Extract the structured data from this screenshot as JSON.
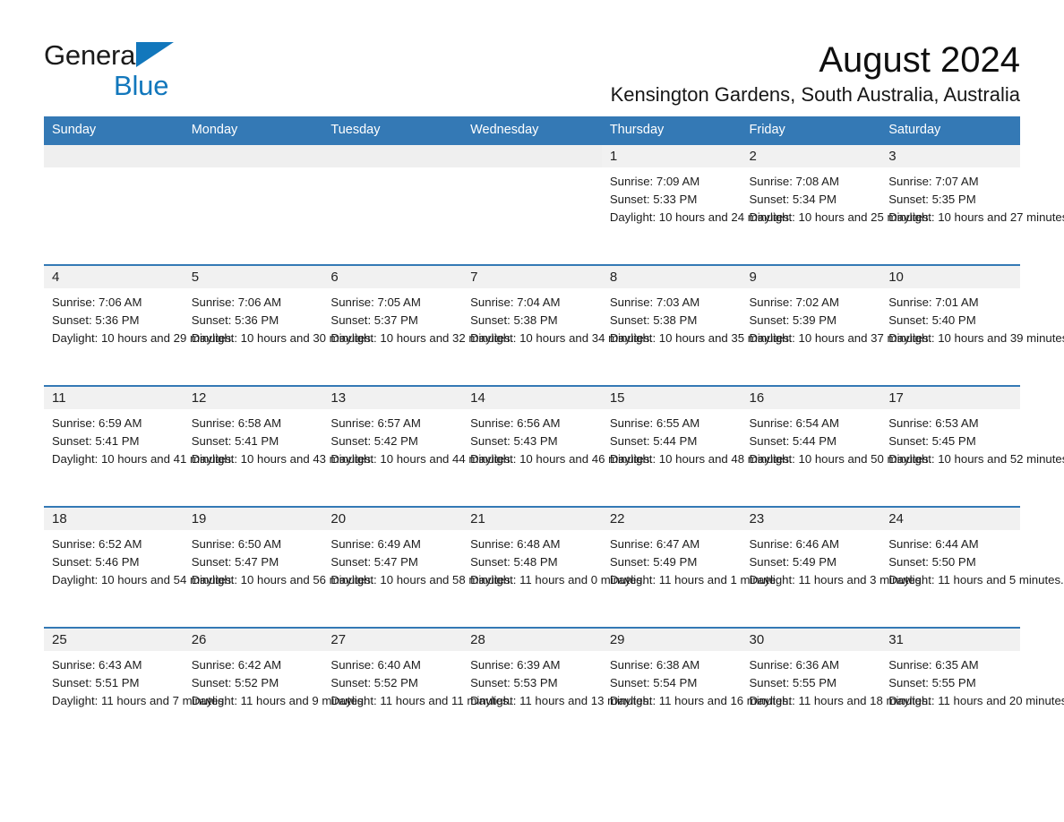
{
  "brand": {
    "word1": "General",
    "word2": "Blue",
    "triangle_color": "#1277bc",
    "text_color": "#1b1b1b"
  },
  "header": {
    "title": "August 2024",
    "location": "Kensington Gardens, South Australia, Australia"
  },
  "theme": {
    "header_bg": "#3479b5",
    "header_text": "#ffffff",
    "daynum_band_bg": "#f1f1f1",
    "row_divider": "#3479b5",
    "page_bg": "#ffffff"
  },
  "calendar": {
    "weekday_headers": [
      "Sunday",
      "Monday",
      "Tuesday",
      "Wednesday",
      "Thursday",
      "Friday",
      "Saturday"
    ],
    "labels": {
      "sunrise": "Sunrise:",
      "sunset": "Sunset:",
      "daylight": "Daylight:"
    },
    "weeks": [
      [
        {
          "day": "",
          "sunrise": "",
          "sunset": "",
          "daylight": ""
        },
        {
          "day": "",
          "sunrise": "",
          "sunset": "",
          "daylight": ""
        },
        {
          "day": "",
          "sunrise": "",
          "sunset": "",
          "daylight": ""
        },
        {
          "day": "",
          "sunrise": "",
          "sunset": "",
          "daylight": ""
        },
        {
          "day": "1",
          "sunrise": "Sunrise: 7:09 AM",
          "sunset": "Sunset: 5:33 PM",
          "daylight": "Daylight: 10 hours and 24 minutes."
        },
        {
          "day": "2",
          "sunrise": "Sunrise: 7:08 AM",
          "sunset": "Sunset: 5:34 PM",
          "daylight": "Daylight: 10 hours and 25 minutes."
        },
        {
          "day": "3",
          "sunrise": "Sunrise: 7:07 AM",
          "sunset": "Sunset: 5:35 PM",
          "daylight": "Daylight: 10 hours and 27 minutes."
        }
      ],
      [
        {
          "day": "4",
          "sunrise": "Sunrise: 7:06 AM",
          "sunset": "Sunset: 5:36 PM",
          "daylight": "Daylight: 10 hours and 29 minutes."
        },
        {
          "day": "5",
          "sunrise": "Sunrise: 7:06 AM",
          "sunset": "Sunset: 5:36 PM",
          "daylight": "Daylight: 10 hours and 30 minutes."
        },
        {
          "day": "6",
          "sunrise": "Sunrise: 7:05 AM",
          "sunset": "Sunset: 5:37 PM",
          "daylight": "Daylight: 10 hours and 32 minutes."
        },
        {
          "day": "7",
          "sunrise": "Sunrise: 7:04 AM",
          "sunset": "Sunset: 5:38 PM",
          "daylight": "Daylight: 10 hours and 34 minutes."
        },
        {
          "day": "8",
          "sunrise": "Sunrise: 7:03 AM",
          "sunset": "Sunset: 5:38 PM",
          "daylight": "Daylight: 10 hours and 35 minutes."
        },
        {
          "day": "9",
          "sunrise": "Sunrise: 7:02 AM",
          "sunset": "Sunset: 5:39 PM",
          "daylight": "Daylight: 10 hours and 37 minutes."
        },
        {
          "day": "10",
          "sunrise": "Sunrise: 7:01 AM",
          "sunset": "Sunset: 5:40 PM",
          "daylight": "Daylight: 10 hours and 39 minutes."
        }
      ],
      [
        {
          "day": "11",
          "sunrise": "Sunrise: 6:59 AM",
          "sunset": "Sunset: 5:41 PM",
          "daylight": "Daylight: 10 hours and 41 minutes."
        },
        {
          "day": "12",
          "sunrise": "Sunrise: 6:58 AM",
          "sunset": "Sunset: 5:41 PM",
          "daylight": "Daylight: 10 hours and 43 minutes."
        },
        {
          "day": "13",
          "sunrise": "Sunrise: 6:57 AM",
          "sunset": "Sunset: 5:42 PM",
          "daylight": "Daylight: 10 hours and 44 minutes."
        },
        {
          "day": "14",
          "sunrise": "Sunrise: 6:56 AM",
          "sunset": "Sunset: 5:43 PM",
          "daylight": "Daylight: 10 hours and 46 minutes."
        },
        {
          "day": "15",
          "sunrise": "Sunrise: 6:55 AM",
          "sunset": "Sunset: 5:44 PM",
          "daylight": "Daylight: 10 hours and 48 minutes."
        },
        {
          "day": "16",
          "sunrise": "Sunrise: 6:54 AM",
          "sunset": "Sunset: 5:44 PM",
          "daylight": "Daylight: 10 hours and 50 minutes."
        },
        {
          "day": "17",
          "sunrise": "Sunrise: 6:53 AM",
          "sunset": "Sunset: 5:45 PM",
          "daylight": "Daylight: 10 hours and 52 minutes."
        }
      ],
      [
        {
          "day": "18",
          "sunrise": "Sunrise: 6:52 AM",
          "sunset": "Sunset: 5:46 PM",
          "daylight": "Daylight: 10 hours and 54 minutes."
        },
        {
          "day": "19",
          "sunrise": "Sunrise: 6:50 AM",
          "sunset": "Sunset: 5:47 PM",
          "daylight": "Daylight: 10 hours and 56 minutes."
        },
        {
          "day": "20",
          "sunrise": "Sunrise: 6:49 AM",
          "sunset": "Sunset: 5:47 PM",
          "daylight": "Daylight: 10 hours and 58 minutes."
        },
        {
          "day": "21",
          "sunrise": "Sunrise: 6:48 AM",
          "sunset": "Sunset: 5:48 PM",
          "daylight": "Daylight: 11 hours and 0 minutes."
        },
        {
          "day": "22",
          "sunrise": "Sunrise: 6:47 AM",
          "sunset": "Sunset: 5:49 PM",
          "daylight": "Daylight: 11 hours and 1 minute."
        },
        {
          "day": "23",
          "sunrise": "Sunrise: 6:46 AM",
          "sunset": "Sunset: 5:49 PM",
          "daylight": "Daylight: 11 hours and 3 minutes."
        },
        {
          "day": "24",
          "sunrise": "Sunrise: 6:44 AM",
          "sunset": "Sunset: 5:50 PM",
          "daylight": "Daylight: 11 hours and 5 minutes."
        }
      ],
      [
        {
          "day": "25",
          "sunrise": "Sunrise: 6:43 AM",
          "sunset": "Sunset: 5:51 PM",
          "daylight": "Daylight: 11 hours and 7 minutes."
        },
        {
          "day": "26",
          "sunrise": "Sunrise: 6:42 AM",
          "sunset": "Sunset: 5:52 PM",
          "daylight": "Daylight: 11 hours and 9 minutes."
        },
        {
          "day": "27",
          "sunrise": "Sunrise: 6:40 AM",
          "sunset": "Sunset: 5:52 PM",
          "daylight": "Daylight: 11 hours and 11 minutes."
        },
        {
          "day": "28",
          "sunrise": "Sunrise: 6:39 AM",
          "sunset": "Sunset: 5:53 PM",
          "daylight": "Daylight: 11 hours and 13 minutes."
        },
        {
          "day": "29",
          "sunrise": "Sunrise: 6:38 AM",
          "sunset": "Sunset: 5:54 PM",
          "daylight": "Daylight: 11 hours and 16 minutes."
        },
        {
          "day": "30",
          "sunrise": "Sunrise: 6:36 AM",
          "sunset": "Sunset: 5:55 PM",
          "daylight": "Daylight: 11 hours and 18 minutes."
        },
        {
          "day": "31",
          "sunrise": "Sunrise: 6:35 AM",
          "sunset": "Sunset: 5:55 PM",
          "daylight": "Daylight: 11 hours and 20 minutes."
        }
      ]
    ]
  }
}
